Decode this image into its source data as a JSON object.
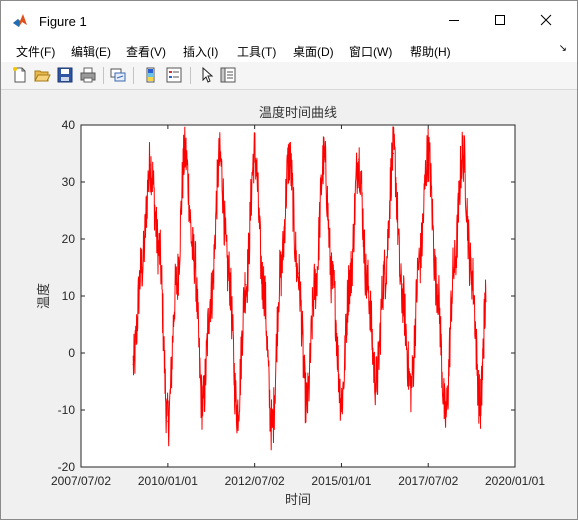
{
  "window": {
    "title": "Figure 1"
  },
  "menu": [
    {
      "label": "文件(F)"
    },
    {
      "label": "编辑(E)"
    },
    {
      "label": "查看(V)"
    },
    {
      "label": "插入(I)"
    },
    {
      "label": "工具(T)"
    },
    {
      "label": "桌面(D)"
    },
    {
      "label": "窗口(W)"
    },
    {
      "label": "帮助(H)"
    }
  ],
  "toolbar": [
    {
      "icon": "new-figure-icon"
    },
    {
      "icon": "open-file-icon"
    },
    {
      "icon": "save-icon"
    },
    {
      "icon": "print-icon"
    },
    {
      "icon": "link-plot-icon"
    },
    {
      "icon": "colorbar-icon"
    },
    {
      "icon": "legend-icon"
    },
    {
      "icon": "edit-plot-arrow-icon"
    },
    {
      "icon": "property-inspector-icon"
    }
  ],
  "chart_data": {
    "type": "line",
    "title": "温度时间曲线",
    "xlabel": "时间",
    "ylabel": "温度",
    "xlim": [
      "2007/07/02",
      "2020/01/01"
    ],
    "ylim": [
      -20,
      40
    ],
    "x_ticks": [
      "2007/07/02",
      "2010/01/01",
      "2012/07/02",
      "2015/01/01",
      "2017/07/02",
      "2020/01/01"
    ],
    "y_ticks": [
      "-20",
      "-10",
      "0",
      "10",
      "20",
      "30",
      "40"
    ],
    "series": [
      {
        "color": "#ff0000",
        "x": [
          "2009/01/01",
          "2009/04/01",
          "2009/07/01",
          "2009/10/01",
          "2010/01/01",
          "2010/04/01",
          "2010/07/01",
          "2010/10/01",
          "2011/01/01",
          "2011/04/01",
          "2011/07/01",
          "2011/10/01",
          "2012/01/01",
          "2012/04/01",
          "2012/07/01",
          "2012/10/01",
          "2013/01/01",
          "2013/04/01",
          "2013/07/01",
          "2013/10/01",
          "2014/01/01",
          "2014/04/01",
          "2014/07/01",
          "2014/10/01",
          "2015/01/01",
          "2015/04/01",
          "2015/07/01",
          "2015/10/01",
          "2016/01/01",
          "2016/04/01",
          "2016/07/01",
          "2016/10/01",
          "2017/01/01",
          "2017/04/01",
          "2017/07/01",
          "2017/10/01",
          "2018/01/01",
          "2018/04/01",
          "2018/07/01",
          "2018/10/01",
          "2019/01/01",
          "2019/03/01"
        ],
        "y": [
          -2,
          15,
          33,
          18,
          -12,
          12,
          35,
          17,
          -9,
          10,
          34,
          14,
          -10,
          12,
          35,
          12,
          -13,
          14,
          34,
          14,
          -9,
          12,
          34,
          12,
          -8,
          13,
          34,
          12,
          -5,
          14,
          35,
          10,
          -6,
          16,
          35,
          12,
          -11,
          15,
          35,
          14,
          -9,
          9
        ]
      }
    ]
  }
}
